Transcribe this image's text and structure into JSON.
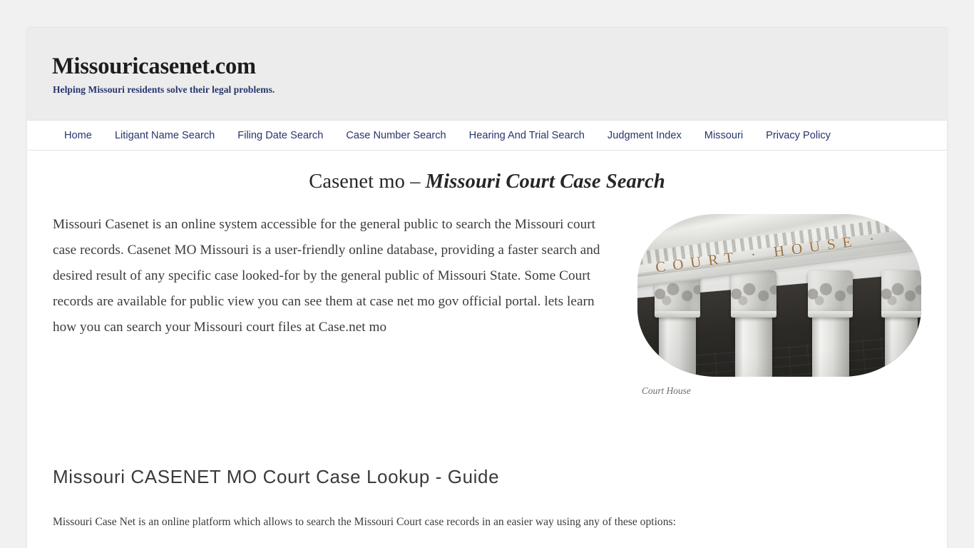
{
  "site": {
    "title": "Missouricasenet.com",
    "tagline": "Helping Missouri residents solve their legal problems."
  },
  "nav": {
    "items": [
      {
        "label": "Home",
        "name": "nav-link-home"
      },
      {
        "label": "Litigant Name Search",
        "name": "nav-link-litigant-name-search"
      },
      {
        "label": "Filing Date Search",
        "name": "nav-link-filing-date-search"
      },
      {
        "label": "Case Number Search",
        "name": "nav-link-case-number-search"
      },
      {
        "label": "Hearing And Trial Search",
        "name": "nav-link-hearing-and-trial-search"
      },
      {
        "label": "Judgment Index",
        "name": "nav-link-judgment-index"
      },
      {
        "label": "Missouri",
        "name": "nav-link-missouri"
      },
      {
        "label": "Privacy Policy",
        "name": "nav-link-privacy-policy"
      }
    ]
  },
  "article": {
    "title_plain": "Casenet mo – ",
    "title_emphasis": "Missouri Court Case Search",
    "intro_paragraph": "Missouri Casenet is an online system accessible for the general public to search the Missouri court case records. Casenet MO Missouri is a user-friendly online database, providing a faster search and desired result of any specific case looked-for by the general public of Missouri State. Some Court records are available for public view you can see them at case net mo gov official portal. lets learn how you can search your Missouri court files at Case.net mo",
    "figure": {
      "caption": "Court House",
      "inscription": "COURT · HOUSE ·",
      "alt": "courthouse-facade-image"
    },
    "section_heading": "Missouri CASENET MO Court Case Lookup - Guide",
    "section_paragraph": "Missouri Case Net is an online platform which allows to search the Missouri Court case records in an easier way using any of these options:"
  },
  "colors": {
    "page_background": "#f1f1f1",
    "content_background": "#ffffff",
    "masthead_background": "#ececec",
    "link_navy": "#27356c",
    "body_text": "#3b3b3b",
    "caption_gray": "#6c6c6c",
    "inscription_bronze": "#9c7240"
  }
}
